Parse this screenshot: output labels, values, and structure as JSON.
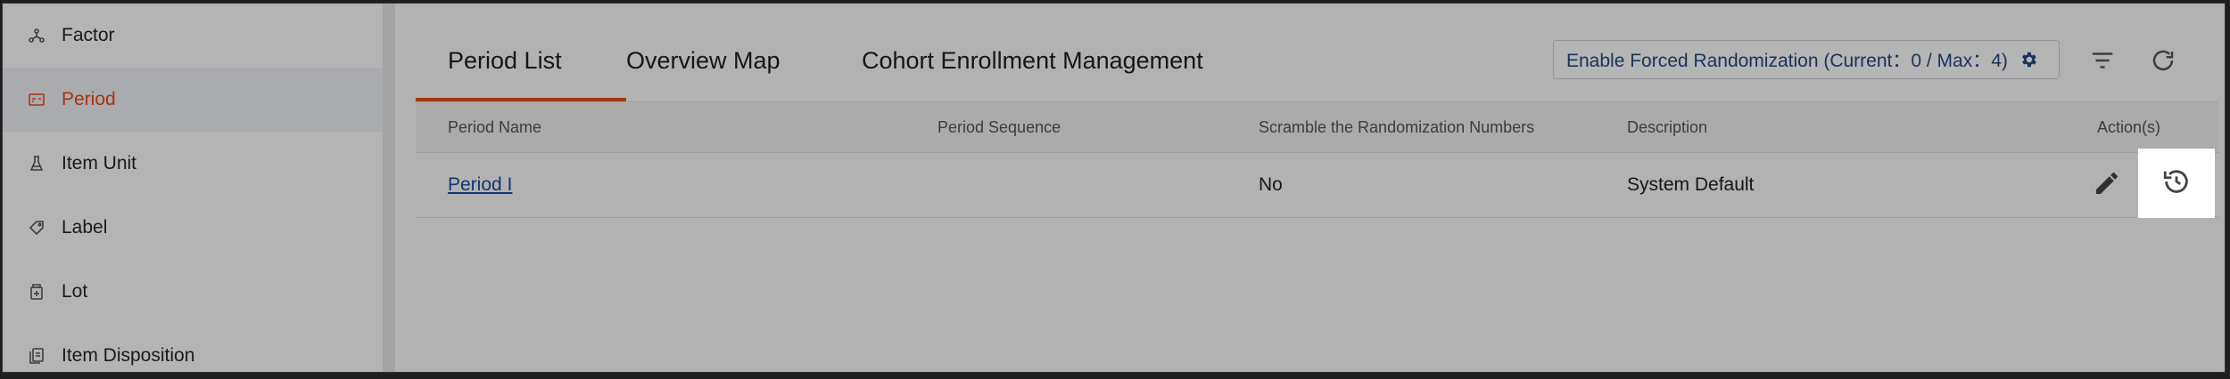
{
  "sidebar": {
    "items": [
      {
        "label": "Factor",
        "icon": "factor-icon",
        "active": false
      },
      {
        "label": "Period",
        "icon": "period-icon",
        "active": true
      },
      {
        "label": "Item Unit",
        "icon": "flask-icon",
        "active": false
      },
      {
        "label": "Label",
        "icon": "tag-icon",
        "active": false
      },
      {
        "label": "Lot",
        "icon": "lot-icon",
        "active": false
      },
      {
        "label": "Item Disposition",
        "icon": "document-icon",
        "active": false
      }
    ]
  },
  "tabs": [
    {
      "label": "Period List",
      "active": true
    },
    {
      "label": "Overview Map",
      "active": false
    },
    {
      "label": "Cohort Enrollment Management",
      "active": false
    }
  ],
  "toolbar": {
    "forced_randomization_label": "Enable Forced Randomization (Current：0 / Max：4)"
  },
  "table": {
    "columns": [
      "Period Name",
      "Period Sequence",
      "Scramble the Randomization Numbers",
      "Description",
      "Action(s)"
    ],
    "rows": [
      {
        "period_name": "Period I",
        "period_sequence": "",
        "scramble": "No",
        "description": "System Default"
      }
    ]
  },
  "colors": {
    "accent": "#e64a19",
    "link": "#1a4aa0",
    "button_text": "#28497a"
  }
}
